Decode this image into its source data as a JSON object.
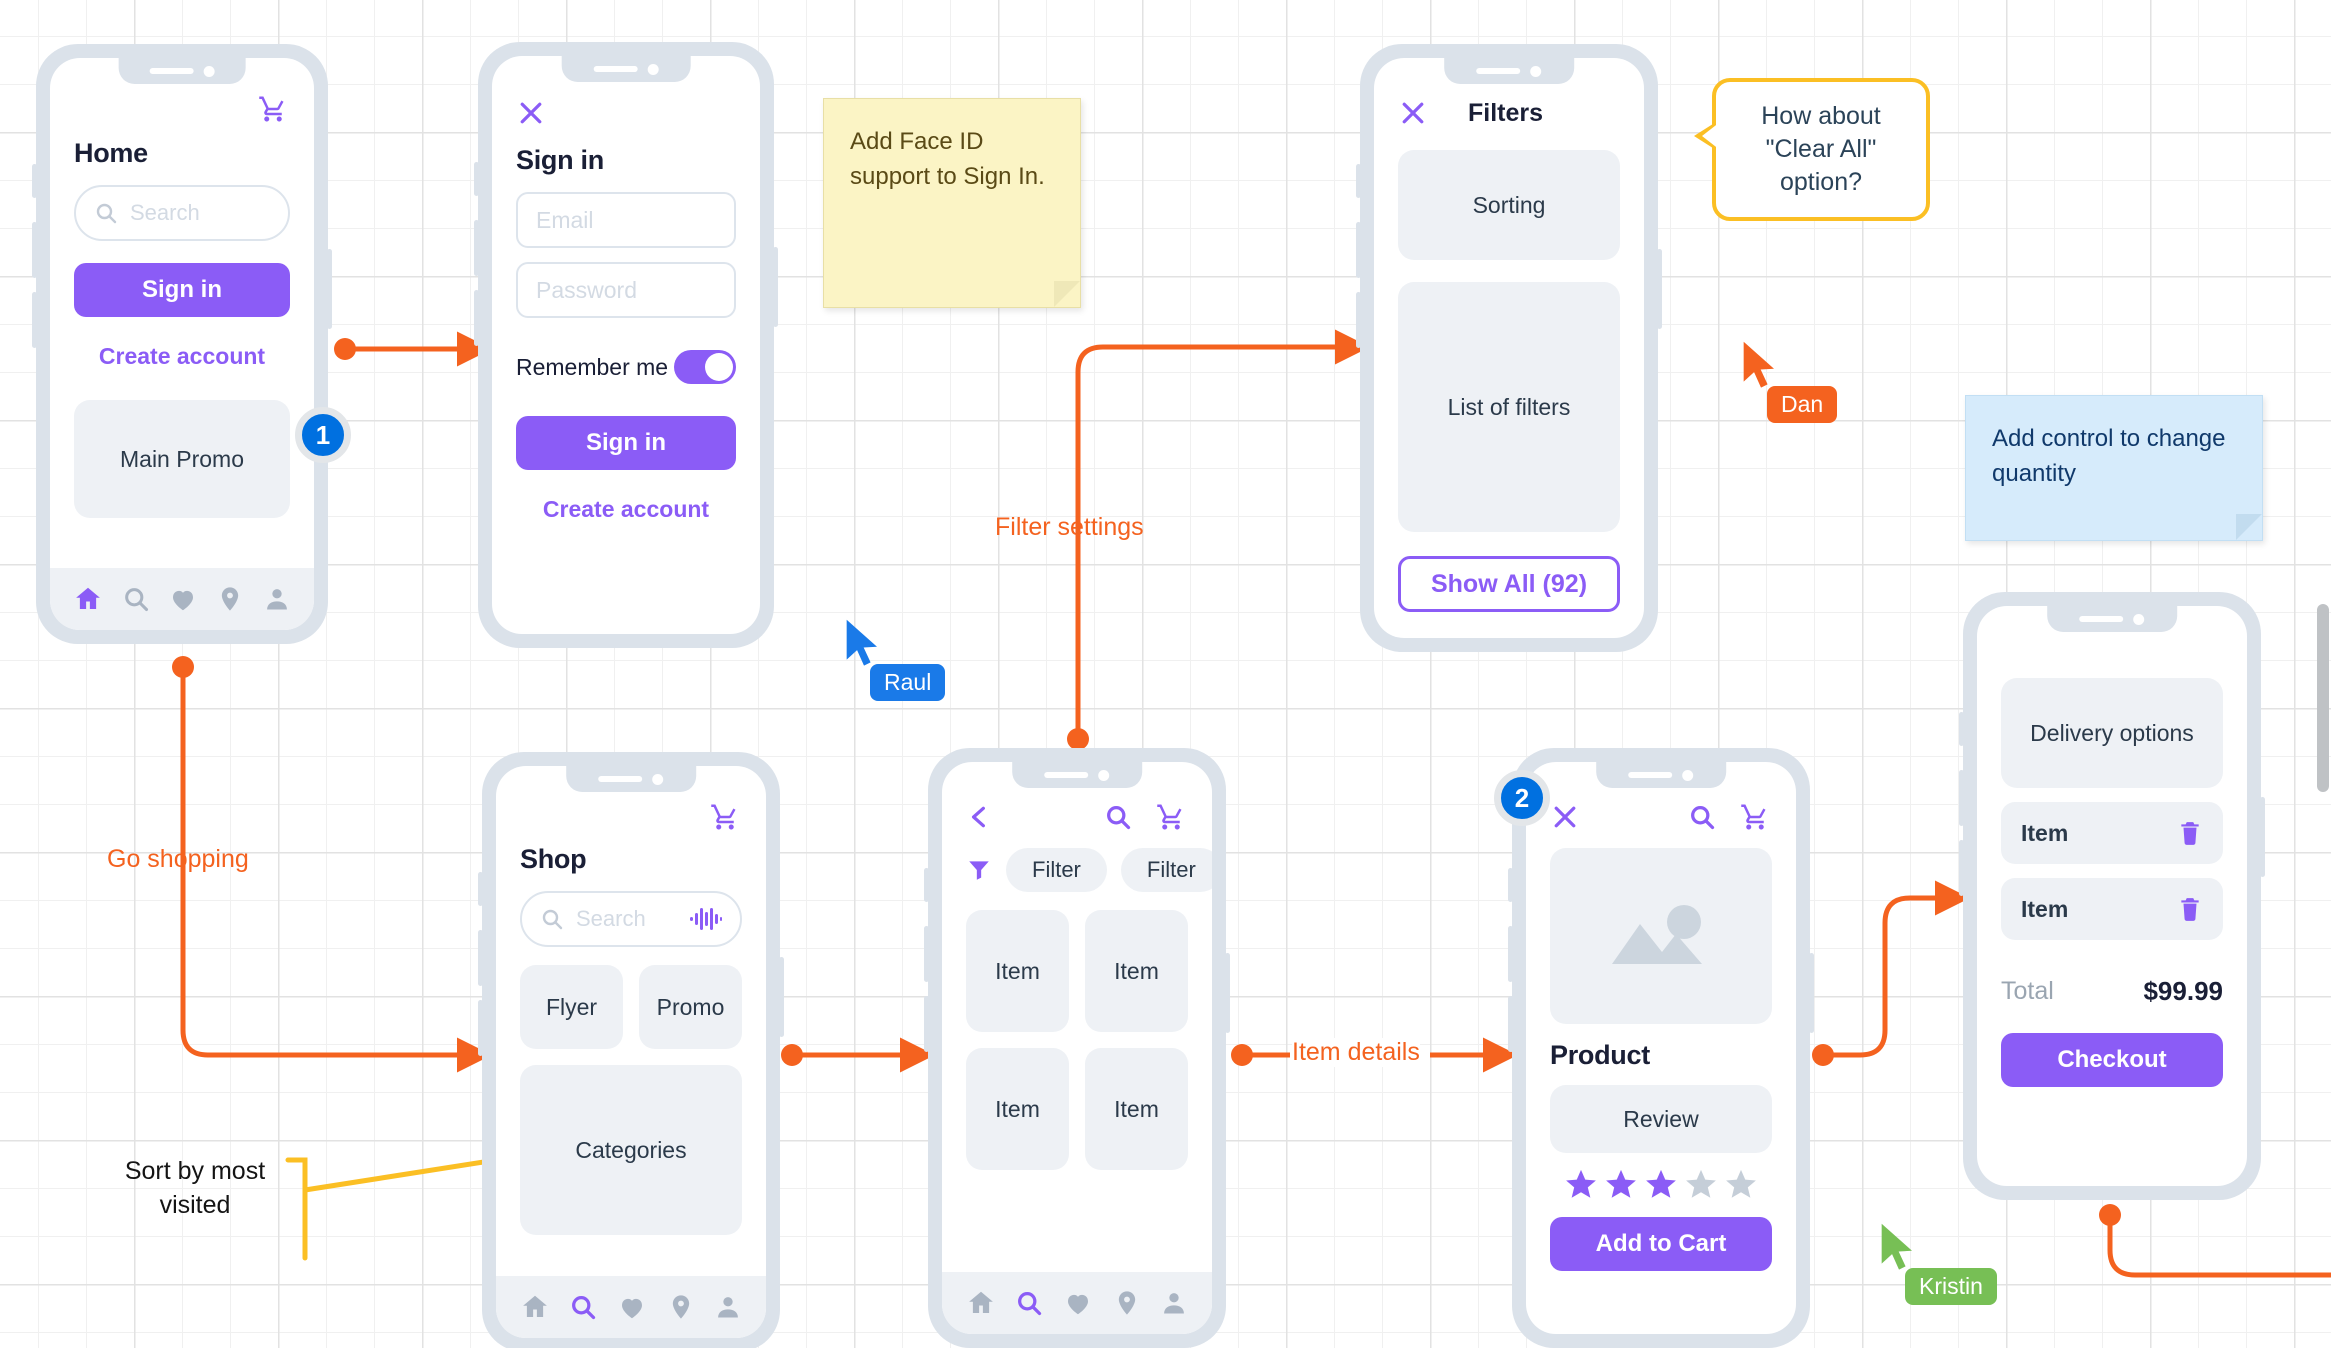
{
  "screens": {
    "home": {
      "title": "Home",
      "search_placeholder": "Search",
      "signin_label": "Sign in",
      "create_account_label": "Create account",
      "promo_label": "Main Promo",
      "cart_icon": "cart-icon",
      "tabbar": [
        "home-icon",
        "search-icon",
        "heart-icon",
        "location-pin-icon",
        "person-icon"
      ]
    },
    "signin": {
      "close_icon": "close-icon",
      "title": "Sign in",
      "email_placeholder": "Email",
      "password_placeholder": "Password",
      "remember_label": "Remember me",
      "remember_on": true,
      "signin_label": "Sign in",
      "create_account_label": "Create account"
    },
    "filters": {
      "close_icon": "close-icon",
      "title": "Filters",
      "sorting_label": "Sorting",
      "list_label": "List of filters",
      "show_all_label": "Show All (92)"
    },
    "shop": {
      "title": "Shop",
      "cart_icon": "cart-icon",
      "search_placeholder": "Search",
      "voice_icon": "voice-waveform-icon",
      "tiles": [
        "Flyer",
        "Promo"
      ],
      "categories_label": "Categories",
      "tabbar": [
        "home-icon",
        "search-icon",
        "heart-icon",
        "location-pin-icon",
        "person-icon"
      ]
    },
    "catalog": {
      "back_icon": "chevron-left-icon",
      "search_icon": "search-icon",
      "cart_icon": "cart-icon",
      "filter_icon": "funnel-icon",
      "filter_chips": [
        "Filter",
        "Filter"
      ],
      "items": [
        "Item",
        "Item",
        "Item",
        "Item"
      ],
      "tabbar": [
        "home-icon",
        "search-icon",
        "heart-icon",
        "location-pin-icon",
        "person-icon"
      ]
    },
    "product": {
      "close_icon": "close-icon",
      "search_icon": "search-icon",
      "cart_icon": "cart-icon",
      "image_placeholder_icon": "image-placeholder-icon",
      "title": "Product",
      "review_label": "Review",
      "rating_filled": 3,
      "rating_total": 5,
      "add_to_cart_label": "Add to Cart"
    },
    "cart": {
      "delivery_label": "Delivery options",
      "rows": [
        {
          "label": "Item",
          "action_icon": "trash-icon"
        },
        {
          "label": "Item",
          "action_icon": "trash-icon"
        }
      ],
      "total_label": "Total",
      "total_value": "$99.99",
      "checkout_label": "Checkout"
    }
  },
  "notes": [
    {
      "id": "face-id-note",
      "text": "Add Face ID support to Sign In.",
      "color": "#fbf4c5"
    },
    {
      "id": "quantity-note",
      "text": "Add control to change quantity",
      "color": "#d6ebfb"
    }
  ],
  "comment_bubble": {
    "text": "How about \"Clear All\" option?",
    "border_color": "#fbbf24"
  },
  "annotations": {
    "go_shopping": "Go shopping",
    "filter_settings": "Filter settings",
    "item_details": "Item details",
    "sort_by_most_visited": "Sort by most visited"
  },
  "steps": [
    {
      "number": "1"
    },
    {
      "number": "2"
    }
  ],
  "cursors": [
    {
      "name": "Dan",
      "color": "#f4621f"
    },
    {
      "name": "Raul",
      "color": "#1a7ae8"
    },
    {
      "name": "Kristin",
      "color": "#77bf55"
    }
  ],
  "colors": {
    "accent_purple": "#8b5cf6",
    "connector_orange": "#f4621f",
    "highlight_yellow": "#fbbf24",
    "step_blue": "#0070e0"
  }
}
